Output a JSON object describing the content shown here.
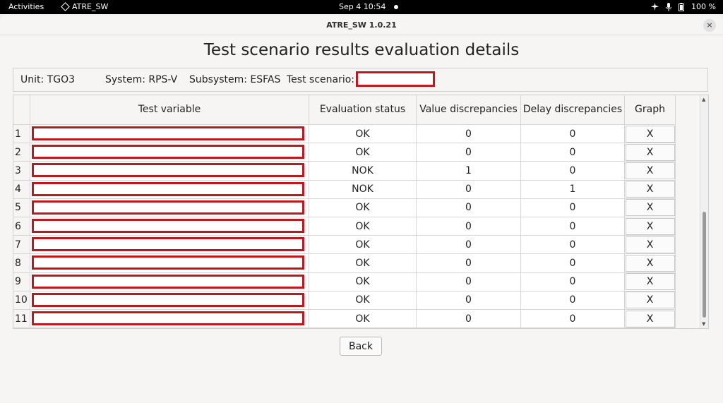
{
  "topbar": {
    "activities": "Activities",
    "app_name": "ATRE_SW",
    "clock": "Sep 4  10:54",
    "battery": "100 %"
  },
  "window": {
    "title": "ATRE_SW 1.0.21",
    "close_label": "×"
  },
  "heading": "Test scenario results evaluation details",
  "info": {
    "unit": "Unit: TGO3",
    "system": "System: RPS-V",
    "subsystem": "Subsystem: ESFAS",
    "test_scenario_label": "Test scenario:"
  },
  "table": {
    "headers": {
      "test_variable": "Test variable",
      "evaluation_status": "Evaluation status",
      "value_discrepancies": "Value discrepancies",
      "delay_discrepancies": "Delay discrepancies",
      "graph": "Graph"
    },
    "rows": [
      {
        "idx": "1",
        "status": "OK",
        "value": "0",
        "delay": "0",
        "graph": "X"
      },
      {
        "idx": "2",
        "status": "OK",
        "value": "0",
        "delay": "0",
        "graph": "X"
      },
      {
        "idx": "3",
        "status": "NOK",
        "value": "1",
        "delay": "0",
        "graph": "X"
      },
      {
        "idx": "4",
        "status": "NOK",
        "value": "0",
        "delay": "1",
        "graph": "X"
      },
      {
        "idx": "5",
        "status": "OK",
        "value": "0",
        "delay": "0",
        "graph": "X"
      },
      {
        "idx": "6",
        "status": "OK",
        "value": "0",
        "delay": "0",
        "graph": "X"
      },
      {
        "idx": "7",
        "status": "OK",
        "value": "0",
        "delay": "0",
        "graph": "X"
      },
      {
        "idx": "8",
        "status": "OK",
        "value": "0",
        "delay": "0",
        "graph": "X"
      },
      {
        "idx": "9",
        "status": "OK",
        "value": "0",
        "delay": "0",
        "graph": "X"
      },
      {
        "idx": "10",
        "status": "OK",
        "value": "0",
        "delay": "0",
        "graph": "X"
      },
      {
        "idx": "11",
        "status": "OK",
        "value": "0",
        "delay": "0",
        "graph": "X"
      }
    ]
  },
  "back_label": "Back",
  "colors": {
    "redaction": "#c0161c"
  }
}
